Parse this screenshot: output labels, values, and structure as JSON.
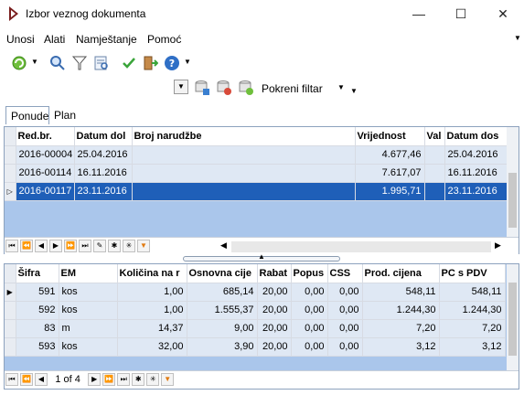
{
  "window": {
    "title": "Izbor veznog dokumenta",
    "minimize": "—",
    "maximize": "☐",
    "close": "✕"
  },
  "menu": {
    "items": [
      "Unosi",
      "Alati",
      "Namještanje",
      "Pomoć"
    ]
  },
  "toolbar2": {
    "filter_label": "Pokreni filtar"
  },
  "tabs": [
    "Ponude",
    "Plan"
  ],
  "top_grid": {
    "columns": [
      "Red.br.",
      "Datum dol",
      "Broj narudžbe",
      "Vrijednost",
      "Val",
      "Datum dos"
    ],
    "rows": [
      [
        "2016-00004",
        "25.04.2016",
        "",
        "4.677,46",
        "",
        "25.04.2016"
      ],
      [
        "2016-00114",
        "16.11.2016",
        "",
        "7.617,07",
        "",
        "16.11.2016"
      ],
      [
        "2016-00117",
        "23.11.2016",
        "",
        "1.995,71",
        "",
        "23.11.2016"
      ]
    ],
    "selected_row": 2
  },
  "bottom_grid": {
    "columns": [
      "Šifra",
      "EM",
      "Količina na r",
      "Osnovna cije",
      "Rabat",
      "Popus",
      "CSS",
      "Prod. cijena",
      "PC s PDV"
    ],
    "rows": [
      [
        "591",
        "kos",
        "1,00",
        "685,14",
        "20,00",
        "0,00",
        "0,00",
        "548,11",
        "548,11"
      ],
      [
        "592",
        "kos",
        "1,00",
        "1.555,37",
        "20,00",
        "0,00",
        "0,00",
        "1.244,30",
        "1.244,30"
      ],
      [
        "83",
        "m",
        "14,37",
        "9,00",
        "20,00",
        "0,00",
        "0,00",
        "7,20",
        "7,20"
      ],
      [
        "593",
        "kos",
        "32,00",
        "3,90",
        "20,00",
        "0,00",
        "0,00",
        "3,12",
        "3,12"
      ]
    ],
    "pager": "1 of 4"
  },
  "colors": {
    "selection": "#1f5fb8",
    "grid_bg": "#aac6eb",
    "row_bg": "#dfe8f4"
  }
}
